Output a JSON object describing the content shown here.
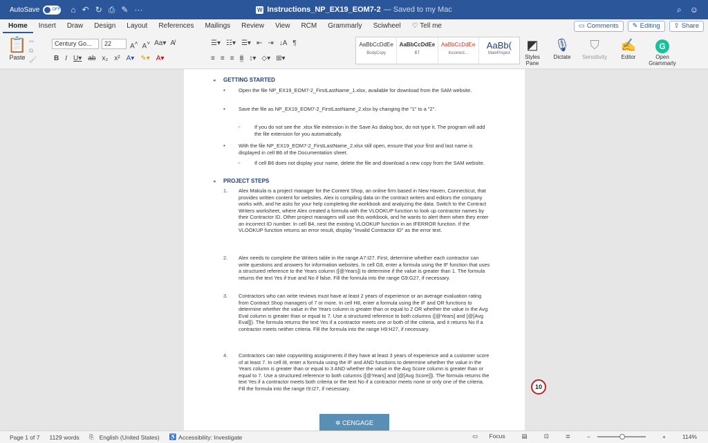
{
  "titlebar": {
    "autosave_label": "AutoSave",
    "autosave_state": "OFF",
    "doc_name": "Instructions_NP_EX19_EOM7-2",
    "saved_status": "— Saved to my Mac"
  },
  "tabs": [
    "Home",
    "Insert",
    "Draw",
    "Design",
    "Layout",
    "References",
    "Mailings",
    "Review",
    "View",
    "RCM",
    "Grammarly",
    "Sciwheel"
  ],
  "tell_me": "Tell me",
  "tab_right": {
    "comments": "Comments",
    "editing": "Editing",
    "share": "Share"
  },
  "ribbon": {
    "paste_label": "Paste",
    "font_name": "Century Go...",
    "font_size": "22",
    "styles": [
      {
        "sample": "AaBbCcDdEe",
        "name": "BodyCopy"
      },
      {
        "sample": "AaBbCcDdEe",
        "name": "BT"
      },
      {
        "sample": "AaBbCcDdEe",
        "name": "Incorrect..."
      },
      {
        "sample": "AaBb(",
        "name": "MainProject"
      }
    ],
    "styles_pane": "Styles Pane",
    "dictate": "Dictate",
    "sensitivity": "Sensitivity",
    "editor": "Editor",
    "open_grammarly": "Open Grammarly"
  },
  "document": {
    "getting_started_heading": "GETTING STARTED",
    "gs1": "Open the file NP_EX19_EOM7-2_FirstLastName_1.xlsx, available for download from the SAM website.",
    "gs2": "Save the file as NP_EX19_EOM7-2_FirstLastName_2.xlsx by changing the \"1\" to a \"2\".",
    "gs2a": "If you do not see the .xlsx file extension in the Save As dialog box, do not type it. The program will add the file extension for you automatically.",
    "gs3": "With the file NP_EX19_EOM7-2_FirstLastName_2.xlsx still open, ensure that your first and last name is displayed in cell B6 of the Documentation sheet.",
    "gs3a": "If cell B6 does not display your name, delete the file and download a new copy from the SAM website.",
    "project_steps_heading": "PROJECT STEPS",
    "steps": [
      {
        "num": "1.",
        "text": "Alex Makula is a project manager for the Content Shop, an online firm based in New Haven, Connecticut, that provides written content for websites. Alex is compiling data on the contract writers and editors the company works with, and he asks for your help completing the workbook and analyzing the data. Switch to the Contract Writers worksheet, where Alex created a formula with the VLOOKUP function to look up contractor names by their Contractor ID. Other project managers will use this workbook, and he wants to alert them when they enter an incorrect ID number. In cell B4, nest the existing VLOOKUP function in an IFERROR function. If the VLOOKUP function returns an error result, display \"Invalid Contractor ID\" as the error text."
      },
      {
        "num": "2.",
        "text": "Alex needs to complete the Writers table in the range A7:I27. First, determine whether each contractor can write questions and answers for information websites. In cell G8, enter a formula using the IF function that uses a structured reference to the Years column ([@Years]) to determine if the value is greater than 1. The formula returns the text Yes if true and No if false. Fill the formula into the range G9:G27, if necessary."
      },
      {
        "num": "3.",
        "text": "Contractors who can write reviews must have at least 2 years of experience or an average evaluation rating from Contract Shop managers of 7 or more. In cell H8, enter a formula using the IF and OR functions to determine whether the value in the Years column is greater than or equal to 2 OR whether the value in the Avg Eval column is greater than or equal to 7. Use a structured reference to both columns ([@Years] and [@[Avg Eval]]). The formula returns the text Yes if a contractor meets one or both of the criteria, and it returns No if a contractor meets neither criteria. Fill the formula into the range H9:H27, if necessary."
      },
      {
        "num": "4.",
        "text": "Contractors can take copywriting assignments if they have at least 3 years of experience and a customer score of at least 7. In cell I8, enter a formula using the IF and AND functions to determine whether the value in the Years column is greater than or equal to 3 AND whether the value in the Avg Score column is greater than or equal to 7. Use a structured reference to both columns ([@Years] and [@[Avg Score]]). The formula returns the text Yes if a contractor meets both criteria or the text No if a contractor meets none or only one of the criteria. Fill the formula into the range I9:I27, if necessary."
      }
    ],
    "cengage": "CENGAGE",
    "badge": "10"
  },
  "status": {
    "page": "Page 1 of 7",
    "words": "1129 words",
    "language": "English (United States)",
    "accessibility": "Accessibility: Investigate",
    "focus": "Focus",
    "zoom": "114%"
  }
}
